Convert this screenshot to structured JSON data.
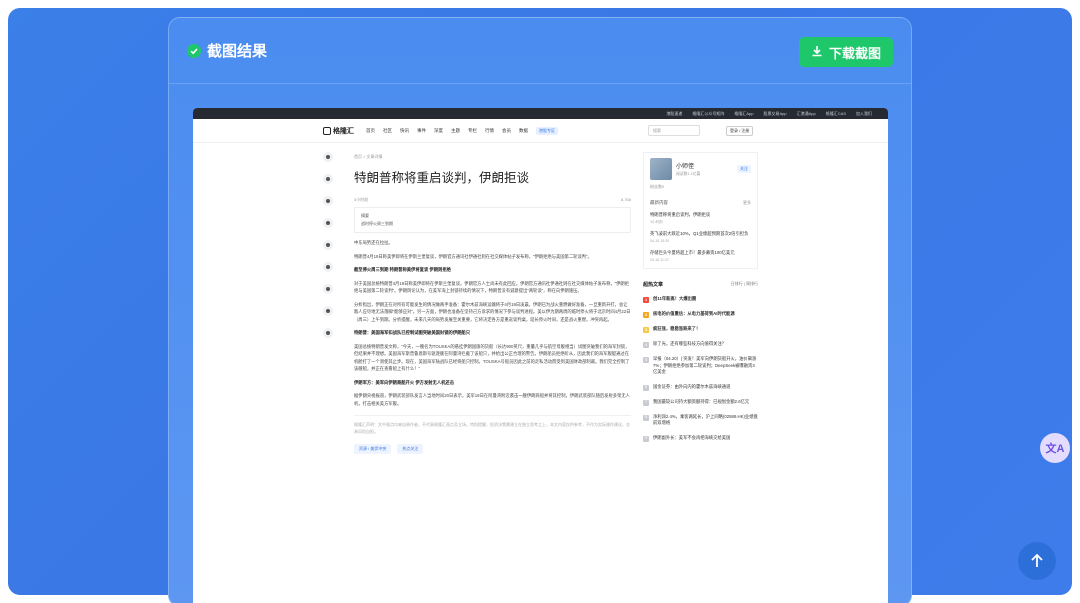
{
  "colors": {
    "background": "#3b7fe8",
    "modal": "#4a8cf0",
    "download": "#1fc76b",
    "accent": "#3a78e6"
  },
  "modal": {
    "title": "截图结果",
    "download_label": "下载截图"
  },
  "site": {
    "topbar": [
      "港股速递",
      "格隆汇公众号矩阵",
      "格隆汇App",
      "股票交易App",
      "汇港通App",
      "格隆汇CAS",
      "加入我们"
    ],
    "logo": "格隆汇",
    "nav": [
      "首页",
      "社区",
      "快讯",
      "事件",
      "深度",
      "主题",
      "专栏",
      "行情",
      "会员",
      "数据"
    ],
    "nav_tag": "港股专区",
    "search_placeholder": "搜索",
    "login": "登录 / 注册"
  },
  "article": {
    "breadcrumb": "首页 > 文章详情",
    "title": "特朗普称将重启谈判，伊朗拒谈",
    "time": "3小时前",
    "views": "8,768",
    "summary_label": "摘要",
    "summary": "战时停火周三到期",
    "paragraphs": [
      {
        "text": "中东局势还在拉扯。",
        "bold": false
      },
      {
        "text": "特朗普4月19日称美伊即将在伊斯兰堡复谈，伊朗官方通讯社伊通社则在社交媒体帖子发布称，“伊朗拒绝与美国第二轮谈判”。",
        "bold": false
      },
      {
        "text": "截至停火周三到期 特朗普称美伊将复谈 伊朗则拒绝",
        "bold": true
      },
      {
        "text": "对于美国总统特朗普4月19日称美伊即将在伊斯兰堡复谈，伊朗官方人士尚未有此回应。伊朗官方通讯社伊通社则在社交媒体帖子发布称，“伊朗拒绝与美国第二轮谈判”。伊朗舆论认为，在美军海上封锁持续的情况下，特朗普没有诚意提出“两轮谈”，称在向伊朗施压。",
        "bold": false
      },
      {
        "text": "分析指出，伊朗正在对所有可能发生的情况做两手准备：霍尔木兹海峡运输将于4月19日凌晨，伊朗已为战火重燃做好准备，一旦重新开打，会让敌人应尽地无法落脚“能够应对”。另一方面，伊朗也准备在坚持己方诉求的情况下参与谈判进程。美以伊为期两周的临时停火将于北京时间4月22日（周三）上午到期。分析提醒，未来几天的局势发展至关重要，它将决定各方是重返谈判桌，延长停火时间，还是战火重燃，冲突再起。",
        "bold": false
      },
      {
        "text": "特朗普：美国海军扣战队已控制试图突破美国封锁的伊朗船只",
        "bold": true
      },
      {
        "text": "美国总统特朗普发文称，“今天，一艘名为TOUSKA的悬挂伊朗国旗的货船（长达900英尺，重量几乎与航空母舰相当）试图突破我们的海军封锁，但结果并不理想。美国海军斯普鲁恩斯号驱逐舰在阿曼湾拦截了该船只，并给出公正合理的警告。伊朗船员拒绝听从，因此我们的海军舰艇通过在机舱打了一个洞使其止步。现在，美国海军陆战队已经将船只控制。TOUSKA号船员因此之前的走私活动而受到美国财政部制裁。我们完全控制了该艘船，并正在查看船上有什么！”",
        "bold": false
      },
      {
        "text": "伊朗军方：美军向伊朗商船开火 伊方发射无人机还击",
        "bold": true
      },
      {
        "text": "据伊朗央视报道，伊朗武装部队发言人当地时间20日表示，美军19日在阿曼湾附近袭击一艘伊朗商船并将其控制，伊朗武装部队随后发射多架无人机，打击相关美方军舰。",
        "bold": false
      }
    ],
    "disclaimer": "格隆汇声明：文中观点均来自原作者，不代表格隆汇观点及立场。特别提醒，投资决策需建立在独立思考之上，本文内容仅供参考，不作为实际操作建议，交易风险自担。",
    "tags": [
      "资源 / 美伊冲突",
      "热点关注"
    ]
  },
  "sidebar": {
    "author_name": "小师侄",
    "author_sub": "阅读数1.1亿篇",
    "follow": "关注",
    "author_extra": "粉丝数0",
    "latest_title": "最新内容",
    "latest_more": "更多",
    "latest": [
      {
        "title": "特朗普称将重启谈判，伊朗拒谈",
        "time": "3小时前"
      },
      {
        "title": "英飞凌前大跌近10%，Q1业绩超预期首次2倍引担负",
        "time": "04-18 15:30"
      },
      {
        "title": "存储巨头今夏将超上市！最多募资100亿美元",
        "time": "04-16 11:37"
      }
    ],
    "hot_title": "超热文章",
    "hot_tabs": "日排行 | 周排行",
    "hot": [
      {
        "n": "1",
        "title": "创11年新高！大爆出圈",
        "bold": true,
        "c": "r"
      },
      {
        "n": "2",
        "title": "核电的价值重估：从电力基荷到AI时代能源",
        "bold": true,
        "c": "o"
      },
      {
        "n": "3",
        "title": "疯狂涨，稳稳涨跌来了！",
        "bold": true,
        "c": "y"
      },
      {
        "n": "4",
        "title": "除了光，还有哪些科技方向值得关注？",
        "bold": false,
        "c": "g"
      },
      {
        "n": "5",
        "title": "早报（04.20）| 突发！美军向伊朗货船开火，油价飙涨7%；伊朗拒绝参加第二轮谈判；DeepSeek被曝融资3亿美金",
        "bold": false,
        "c": "g"
      },
      {
        "n": "6",
        "title": "国金证券：由外向内的霍尔木兹海峡通道",
        "bold": false,
        "c": "g"
      },
      {
        "n": "7",
        "title": "我国最较公司持大额资额持得：已规划金额2.6亿元",
        "bold": false,
        "c": "g"
      },
      {
        "n": "8",
        "title": "净利润2.4%，乘客两延长，沪上同略(02589.HK)业绩盘前双增格",
        "bold": false,
        "c": "g"
      },
      {
        "n": "9",
        "title": "伊朗副外长：美军不会再把海峡交给美国",
        "bold": false,
        "c": "g"
      }
    ]
  }
}
